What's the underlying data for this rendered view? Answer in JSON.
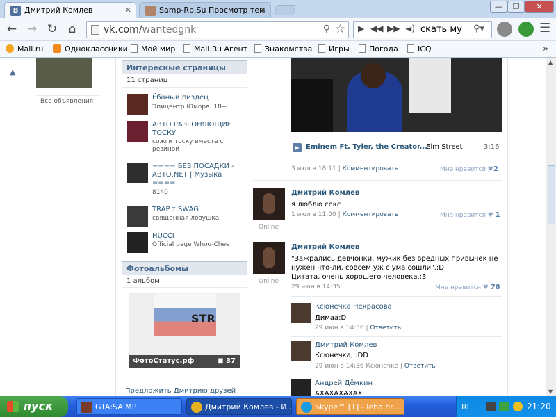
{
  "browser": {
    "tabs": [
      {
        "favicon_text": "В",
        "title": "Дмитрий Комлев"
      },
      {
        "title": "Samp-Rp.Su Просмотр тем"
      }
    ],
    "url_host": "vk.com/",
    "url_path": "wantedgnk",
    "player_text": "скать муз"
  },
  "bookmarks": [
    "Mail.ru",
    "Одноклассники",
    "Мой мир",
    "Mail.Ru Агент",
    "Знакомства",
    "Игры",
    "Погода",
    "ICQ"
  ],
  "left_column": {
    "ads_all_link": "Все объявления"
  },
  "interesting_pages": {
    "header": "Интересные страницы",
    "count": "11 страниц",
    "items": [
      {
        "title": "Ёбаный пиздец",
        "sub": "Эпицентр Юмора. 18+"
      },
      {
        "title": "АВТО РАЗГОНЯЮЩИЕ ТОСКУ",
        "sub": "сожги тоску вместе с резиной"
      },
      {
        "title": "==== БЕЗ ПОСАДКИ - АВТО.NET | Музыка ====",
        "sub": "8140"
      },
      {
        "title": "TRAP † SWAG",
        "sub": "священная ловушка"
      },
      {
        "title": "HUCCI",
        "sub": "Official page Whoo-Chee"
      }
    ]
  },
  "photo_albums": {
    "header": "Фотоальбомы",
    "count": "1 альбом",
    "album_name": "ФотоСтатус.рф",
    "album_count": "37",
    "album_image_text": "STR"
  },
  "suggest_friends": "Предложить Дмитрию друзей",
  "wall": {
    "audio": {
      "title": "Eminem Ft. Tyler, the Creator...",
      "album": "– Elm Street",
      "duration": "3:16"
    },
    "post0": {
      "date": "3 июл в 18:11",
      "comment": "Комментировать",
      "like_label": "Мне нравится",
      "likes": "2"
    },
    "posts": [
      {
        "author": "Дмитрий Комлев",
        "online": "Online",
        "text": "я люблю секс",
        "date": "1 июл в 11:00",
        "comment": "Комментировать",
        "like_label": "Мне нравится",
        "likes": "1"
      },
      {
        "author": "Дмитрий Комлев",
        "online": "Online",
        "text1": "\"Зажрались девчонки, мужик без вредных привычек не",
        "text2": "нужен что-ли, совсем уж с ума сошли\".:D",
        "text3": "Цитата, очень хорошего человека.:3",
        "date": "29 июн в 14:35",
        "like_label": "Мне нравится",
        "likes": "78"
      }
    ],
    "replies": [
      {
        "name": "Ксюнечка Некрасова",
        "text": "Димаа:D",
        "date": "29 июн в 14:36",
        "reply": "Ответить"
      },
      {
        "name": "Дмитрий Комлев",
        "text": "Ксюнечка, :DD",
        "date": "29 июн в 14:36 Ксюнечке",
        "reply": "Ответить"
      },
      {
        "name": "Андрей Дёмкин",
        "text": "АХАХАХАХАХ"
      }
    ]
  },
  "taskbar": {
    "start": "пуск",
    "tasks": [
      "GTA:SA:MP",
      "Дмитрий Комлев - И...",
      "Skype™ [1] - leha.hr..."
    ],
    "lang": "RL",
    "clock": "21:20"
  }
}
